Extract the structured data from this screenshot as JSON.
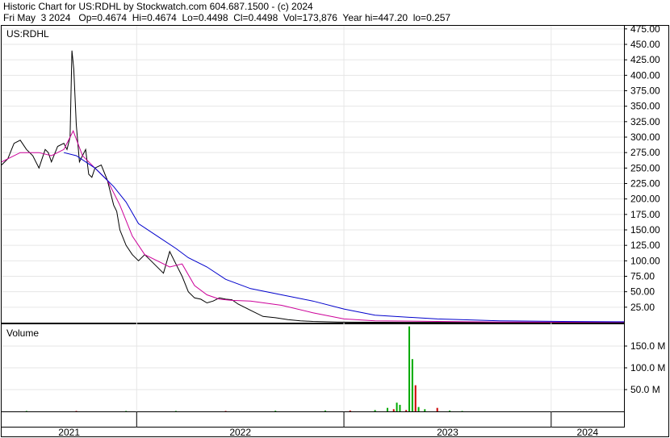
{
  "header": {
    "title": "Historic Chart for US:RDHL by Stockwatch.com 604.687.1500 - (c) 2024",
    "quote": "Fri May  3 2024   Op=0.4674  Hi=0.4674  Lo=0.4498  Cl=0.4498  Vol=173,876  Year hi=447.20  lo=0.257"
  },
  "chart_data": [
    {
      "type": "line",
      "label": "US:RDHL",
      "ylim": [
        0,
        480
      ],
      "yticks": [
        "25.00",
        "50.00",
        "75.00",
        "100.00",
        "125.00",
        "150.00",
        "175.00",
        "200.00",
        "225.00",
        "250.00",
        "275.00",
        "300.00",
        "325.00",
        "350.00",
        "375.00",
        "400.00",
        "425.00",
        "450.00",
        "475.00"
      ],
      "xlabels": [
        "2021",
        "2022",
        "2023",
        "2024"
      ],
      "series": [
        {
          "color": "#000000",
          "x": [
            0,
            0.01,
            0.02,
            0.03,
            0.04,
            0.05,
            0.06,
            0.065,
            0.07,
            0.075,
            0.08,
            0.09,
            0.1,
            0.105,
            0.11,
            0.113,
            0.116,
            0.12,
            0.125,
            0.13,
            0.135,
            0.14,
            0.145,
            0.15,
            0.16,
            0.17,
            0.18,
            0.185,
            0.19,
            0.2,
            0.21,
            0.22,
            0.23,
            0.24,
            0.26,
            0.27,
            0.28,
            0.29,
            0.3,
            0.31,
            0.32,
            0.33,
            0.34,
            0.35,
            0.36,
            0.37,
            0.38,
            0.39,
            0.4,
            0.42,
            0.44,
            0.46,
            0.48,
            0.5,
            0.52,
            0.54,
            0.56,
            0.6,
            0.65,
            0.7,
            0.75,
            0.8,
            0.85,
            0.9,
            0.95,
            1.0
          ],
          "y": [
            255,
            265,
            290,
            295,
            280,
            270,
            250,
            265,
            280,
            275,
            260,
            285,
            290,
            280,
            300,
            440,
            410,
            320,
            260,
            270,
            280,
            240,
            235,
            250,
            255,
            230,
            190,
            180,
            150,
            125,
            110,
            100,
            110,
            100,
            80,
            115,
            95,
            75,
            50,
            40,
            38,
            32,
            35,
            40,
            38,
            37,
            30,
            25,
            20,
            10,
            8,
            5,
            3,
            2,
            1.5,
            1,
            0.8,
            0.6,
            0.5,
            0.5,
            0.5,
            0.5,
            0.5,
            0.5,
            0.5,
            0.5
          ]
        },
        {
          "color": "#cc0099",
          "x": [
            0,
            0.03,
            0.06,
            0.08,
            0.1,
            0.115,
            0.13,
            0.15,
            0.17,
            0.19,
            0.21,
            0.23,
            0.25,
            0.27,
            0.29,
            0.31,
            0.33,
            0.35,
            0.37,
            0.4,
            0.45,
            0.5,
            0.55,
            0.6,
            0.7,
            0.8,
            0.9,
            1.0
          ],
          "y": [
            260,
            275,
            275,
            270,
            280,
            310,
            270,
            250,
            230,
            190,
            140,
            110,
            100,
            90,
            95,
            60,
            45,
            38,
            36,
            35,
            28,
            16,
            6,
            3,
            2,
            1,
            0.8,
            0.8
          ]
        },
        {
          "color": "#0000cc",
          "x": [
            0.1,
            0.12,
            0.15,
            0.18,
            0.2,
            0.22,
            0.25,
            0.28,
            0.3,
            0.33,
            0.36,
            0.4,
            0.45,
            0.5,
            0.55,
            0.6,
            0.7,
            0.8,
            0.9,
            1.0
          ],
          "y": [
            275,
            270,
            250,
            220,
            195,
            160,
            140,
            120,
            105,
            90,
            70,
            55,
            45,
            35,
            22,
            12,
            6,
            3,
            2,
            1.5
          ]
        }
      ]
    },
    {
      "type": "bar",
      "label": "Volume",
      "ylim": [
        0,
        200
      ],
      "yticks": [
        "50.0 M",
        "100.0 M",
        "150.0 M"
      ],
      "x": [
        0.04,
        0.12,
        0.2,
        0.28,
        0.36,
        0.44,
        0.52,
        0.56,
        0.6,
        0.62,
        0.63,
        0.635,
        0.64,
        0.65,
        0.655,
        0.66,
        0.665,
        0.67,
        0.68,
        0.7,
        0.72,
        0.74
      ],
      "values": [
        1,
        1,
        1,
        1,
        1,
        1.5,
        2,
        2,
        3,
        8,
        5,
        20,
        15,
        3,
        195,
        120,
        60,
        10,
        5,
        8,
        2,
        1
      ]
    }
  ]
}
